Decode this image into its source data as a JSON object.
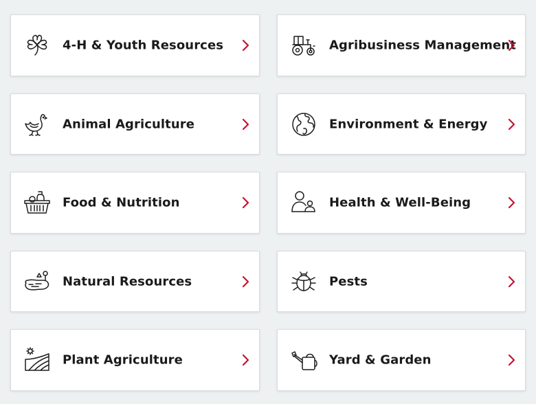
{
  "colors": {
    "accent": "#c41230",
    "text": "#1a1a1a",
    "background": "#eef1f2",
    "card": "#ffffff"
  },
  "cards": [
    {
      "label": "4-H & Youth Resources",
      "icon": "clover-icon"
    },
    {
      "label": "Agribusiness Management",
      "icon": "tractor-icon"
    },
    {
      "label": "Animal Agriculture",
      "icon": "chicken-icon"
    },
    {
      "label": "Environment & Energy",
      "icon": "globe-icon"
    },
    {
      "label": "Food & Nutrition",
      "icon": "food-basket-icon"
    },
    {
      "label": "Health & Well-Being",
      "icon": "person-icon"
    },
    {
      "label": "Natural Resources",
      "icon": "pond-tree-icon"
    },
    {
      "label": "Pests",
      "icon": "beetle-icon"
    },
    {
      "label": "Plant Agriculture",
      "icon": "field-sun-icon"
    },
    {
      "label": "Yard & Garden",
      "icon": "watering-can-icon"
    }
  ],
  "chevron_icon": "chevron-right-icon"
}
